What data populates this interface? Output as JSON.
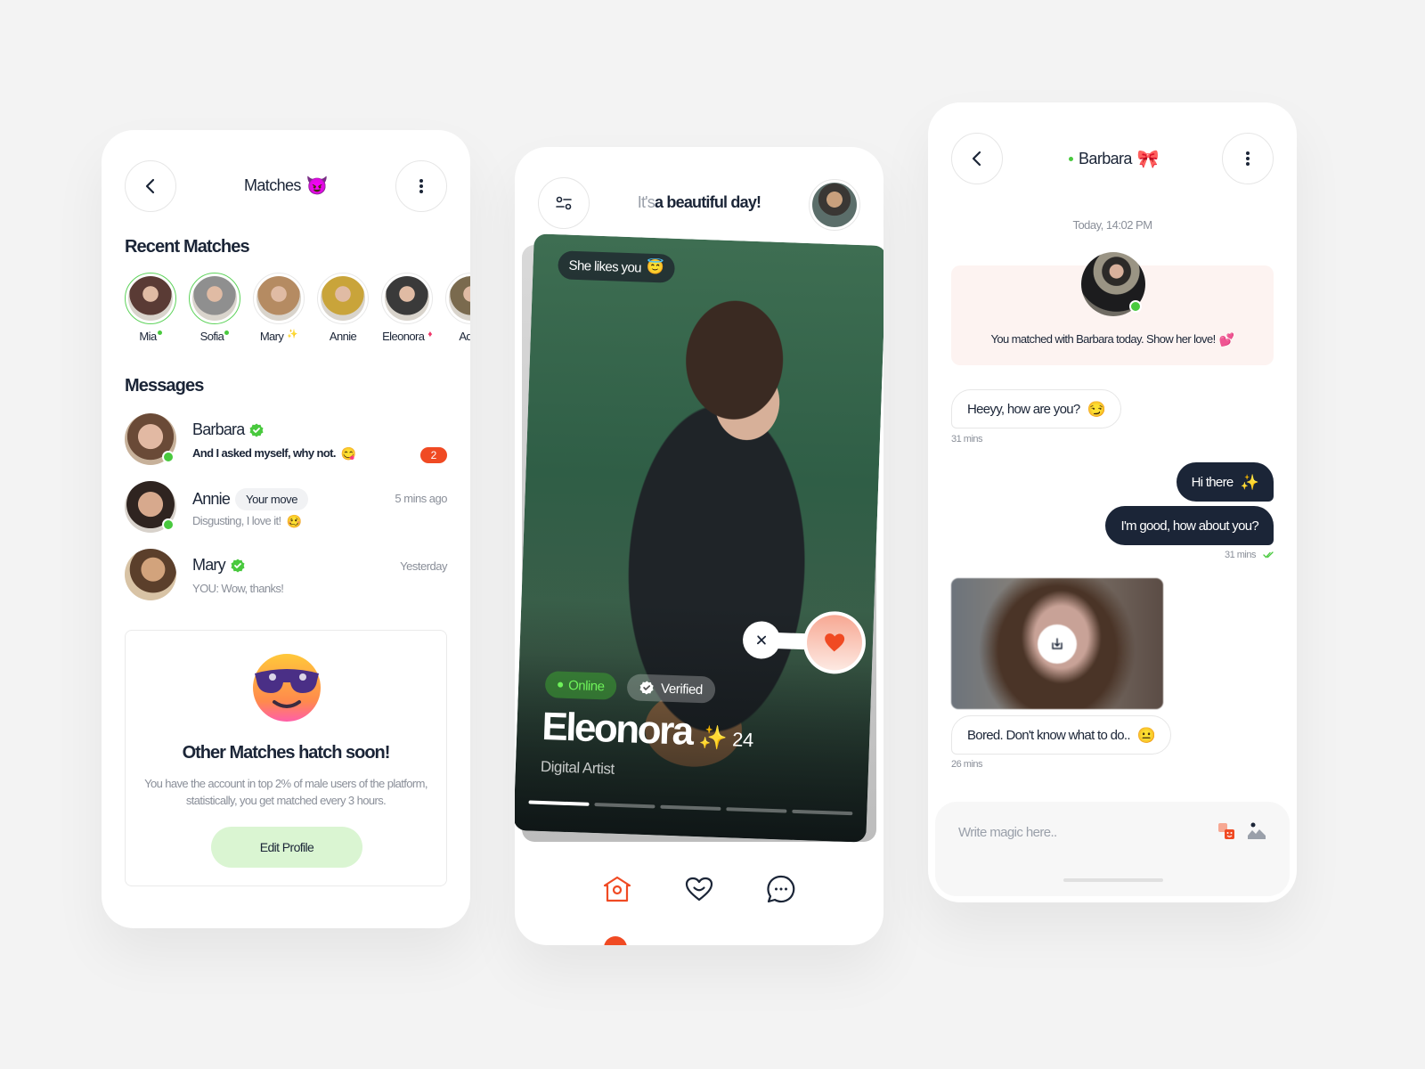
{
  "matches_screen": {
    "header": {
      "title": "Matches",
      "title_emoji": "😈"
    },
    "recent_title": "Recent Matches",
    "recent": [
      {
        "name": "Mia",
        "status": "online",
        "color": "#5a3b35"
      },
      {
        "name": "Sofia",
        "status": "online",
        "color": "#8f8f8f"
      },
      {
        "name": "Mary",
        "status": "sparkle",
        "badge": "✨",
        "color": "#b58b62"
      },
      {
        "name": "Annie",
        "status": "none",
        "color": "#c9a43a"
      },
      {
        "name": "Eleonora",
        "status": "diamond",
        "badge": "♦",
        "color": "#3a3a3a"
      },
      {
        "name": "Adria",
        "status": "none",
        "color": "#7a6a4e"
      }
    ],
    "messages_title": "Messages",
    "messages": [
      {
        "name": "Barbara",
        "verified": true,
        "online": true,
        "text": "And I asked myself, why not.",
        "emoji": "😋",
        "unread_count": "2",
        "time": ""
      },
      {
        "name": "Annie",
        "verified": false,
        "online": true,
        "chip": "Your move",
        "text": "Disgusting, I love it!",
        "emoji": "🥴",
        "time": "5 mins ago"
      },
      {
        "name": "Mary",
        "verified": true,
        "online": false,
        "text": "YOU: Wow, thanks!",
        "emoji": "",
        "time": "Yesterday"
      }
    ],
    "promo": {
      "emoji": "😎",
      "title": "Other Matches hatch soon!",
      "body": "You have the account in top 2% of male users of the platform, statistically, you get matched every 3 hours.",
      "button": "Edit Profile"
    }
  },
  "discover_screen": {
    "greeting_muted": "It's",
    "greeting_strong": "a beautiful day!",
    "card": {
      "likes_chip": "She likes you",
      "likes_emoji": "😇",
      "online_label": "Online",
      "verified_label": "Verified",
      "name": "Eleonora",
      "name_emoji": "✨",
      "age": "24",
      "job": "Digital Artist",
      "photo_index": 1,
      "photo_count": 5
    },
    "tabs": [
      {
        "id": "home",
        "label": "Home",
        "active": true
      },
      {
        "id": "likes",
        "label": "Likes",
        "active": false
      },
      {
        "id": "chat",
        "label": "Chat",
        "active": false
      }
    ],
    "accent": "#f04a23"
  },
  "chat_screen": {
    "header": {
      "name": "Barbara",
      "emoji": "🎀",
      "online": true
    },
    "date": "Today, 14:02 PM",
    "match_banner": {
      "text": "You matched with Barbara today. Show her love!",
      "emoji": "💕"
    },
    "messages": [
      {
        "dir": "in",
        "text": "Heeyy, how are you?",
        "emoji": "😏",
        "time": "31 mins"
      },
      {
        "dir": "out",
        "text": "Hi there",
        "emoji": "✨"
      },
      {
        "dir": "out",
        "text": "I'm good, how about you?",
        "emoji": "",
        "time": "31 mins",
        "read": true
      },
      {
        "dir": "in",
        "type": "image"
      },
      {
        "dir": "in",
        "text": "Bored. Don't know what to do..",
        "emoji": "😐",
        "time": "26 mins"
      }
    ],
    "composer": {
      "placeholder": "Write magic here..",
      "value": ""
    }
  }
}
